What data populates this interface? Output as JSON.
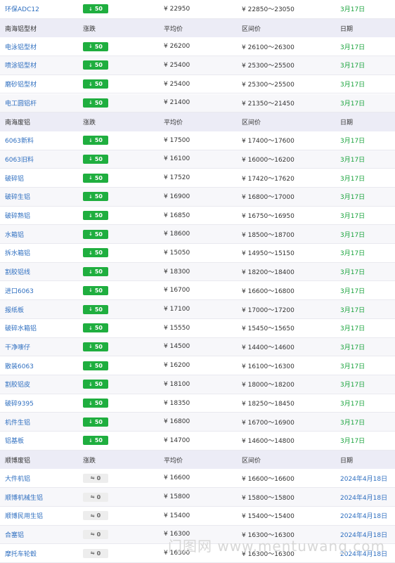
{
  "currency_symbol": "¥",
  "colors": {
    "up": "#1fae3f",
    "header_bg": "#ececf6",
    "link": "#2f6fc0",
    "date_green": "#16a23a",
    "date_blue": "#2f6fc0"
  },
  "top_row": {
    "name": "环保ADC12",
    "change": "50",
    "direction": "down",
    "avg": "22950",
    "range": "22850～23050",
    "date": "3月17日"
  },
  "sections": [
    {
      "header": {
        "name": "南海铝型材",
        "change": "涨跌",
        "avg": "平均价",
        "range": "区间价",
        "date": "日期"
      },
      "rows": [
        {
          "name": "电泳铝型材",
          "change": "50",
          "direction": "down",
          "avg": "26200",
          "range": "26100～26300",
          "date": "3月17日"
        },
        {
          "name": "喷涂铝型材",
          "change": "50",
          "direction": "down",
          "avg": "25400",
          "range": "25300～25500",
          "date": "3月17日"
        },
        {
          "name": "磨砂铝型材",
          "change": "50",
          "direction": "down",
          "avg": "25400",
          "range": "25300～25500",
          "date": "3月17日"
        },
        {
          "name": "电工圆铝杆",
          "change": "50",
          "direction": "down",
          "avg": "21400",
          "range": "21350～21450",
          "date": "3月17日"
        }
      ]
    },
    {
      "header": {
        "name": "南海废铝",
        "change": "涨跌",
        "avg": "平均价",
        "range": "区间价",
        "date": "日期"
      },
      "rows": [
        {
          "name": "6063新料",
          "change": "50",
          "direction": "down",
          "avg": "17500",
          "range": "17400～17600",
          "date": "3月17日"
        },
        {
          "name": "6063旧料",
          "change": "50",
          "direction": "down",
          "avg": "16100",
          "range": "16000～16200",
          "date": "3月17日"
        },
        {
          "name": "破碎铝",
          "change": "50",
          "direction": "down",
          "avg": "17520",
          "range": "17420～17620",
          "date": "3月17日"
        },
        {
          "name": "破碎生铝",
          "change": "50",
          "direction": "down",
          "avg": "16900",
          "range": "16800～17000",
          "date": "3月17日"
        },
        {
          "name": "破碎熟铝",
          "change": "50",
          "direction": "down",
          "avg": "16850",
          "range": "16750～16950",
          "date": "3月17日"
        },
        {
          "name": "水箱铝",
          "change": "50",
          "direction": "down",
          "avg": "18600",
          "range": "18500～18700",
          "date": "3月17日"
        },
        {
          "name": "拆水箱铝",
          "change": "50",
          "direction": "down",
          "avg": "15050",
          "range": "14950～15150",
          "date": "3月17日"
        },
        {
          "name": "割胶铝线",
          "change": "50",
          "direction": "down",
          "avg": "18300",
          "range": "18200～18400",
          "date": "3月17日"
        },
        {
          "name": "进口6063",
          "change": "50",
          "direction": "down",
          "avg": "16700",
          "range": "16600～16800",
          "date": "3月17日"
        },
        {
          "name": "报纸板",
          "change": "50",
          "direction": "down",
          "avg": "17100",
          "range": "17000～17200",
          "date": "3月17日"
        },
        {
          "name": "破碎水箱铝",
          "change": "50",
          "direction": "down",
          "avg": "15550",
          "range": "15450～15650",
          "date": "3月17日"
        },
        {
          "name": "干净嘜仔",
          "change": "50",
          "direction": "down",
          "avg": "14500",
          "range": "14400～14600",
          "date": "3月17日"
        },
        {
          "name": "散装6063",
          "change": "50",
          "direction": "down",
          "avg": "16200",
          "range": "16100～16300",
          "date": "3月17日"
        },
        {
          "name": "割胶铝皮",
          "change": "50",
          "direction": "down",
          "avg": "18100",
          "range": "18000～18200",
          "date": "3月17日"
        },
        {
          "name": "破碎9395",
          "change": "50",
          "direction": "down",
          "avg": "18350",
          "range": "18250～18450",
          "date": "3月17日"
        },
        {
          "name": "机件生铝",
          "change": "50",
          "direction": "down",
          "avg": "16800",
          "range": "16700～16900",
          "date": "3月17日"
        },
        {
          "name": "铝基板",
          "change": "50",
          "direction": "down",
          "avg": "14700",
          "range": "14600～14800",
          "date": "3月17日"
        }
      ]
    },
    {
      "header": {
        "name": "顺博废铝",
        "change": "涨跌",
        "avg": "平均价",
        "range": "区间价",
        "date": "日期"
      },
      "rows": [
        {
          "name": "大件机铝",
          "change": "0",
          "direction": "flat",
          "avg": "16600",
          "range": "16600～16600",
          "date": "2024年4月18日"
        },
        {
          "name": "顺博机械生铝",
          "change": "0",
          "direction": "flat",
          "avg": "15800",
          "range": "15800～15800",
          "date": "2024年4月18日"
        },
        {
          "name": "顺博民用生铝",
          "change": "0",
          "direction": "flat",
          "avg": "15400",
          "range": "15400～15400",
          "date": "2024年4月18日"
        },
        {
          "name": "合塞铝",
          "change": "0",
          "direction": "flat",
          "avg": "16300",
          "range": "16300～16300",
          "date": "2024年4月18日"
        },
        {
          "name": "摩托车轮毂",
          "change": "0",
          "direction": "flat",
          "avg": "16300",
          "range": "16300～16300",
          "date": "2024年4月18日"
        }
      ]
    }
  ],
  "watermark": "门图网 www.mentuwang.com"
}
